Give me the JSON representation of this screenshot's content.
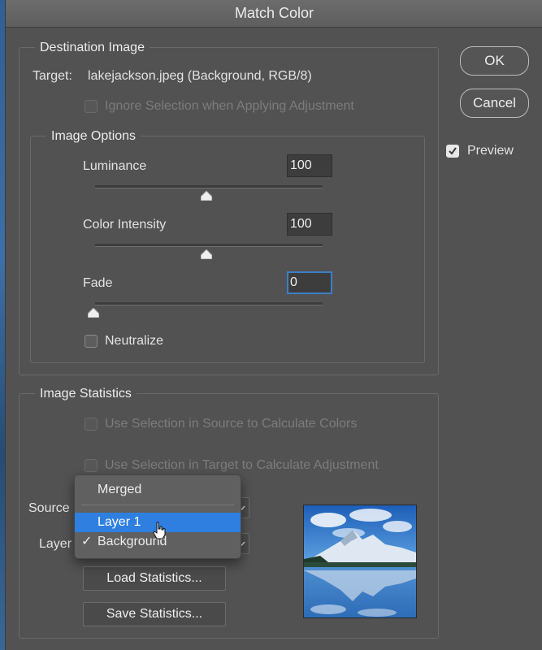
{
  "dialog": {
    "title": "Match Color"
  },
  "buttons": {
    "ok": "OK",
    "cancel": "Cancel"
  },
  "preview": {
    "label": "Preview",
    "checked": true
  },
  "destination": {
    "legend": "Destination Image",
    "target_label": "Target:",
    "target_value": "lakejackson.jpeg (Background, RGB/8)",
    "ignore_selection": "Ignore Selection when Applying Adjustment"
  },
  "image_options": {
    "legend": "Image Options",
    "luminance": {
      "label": "Luminance",
      "value": "100"
    },
    "color_intensity": {
      "label": "Color Intensity",
      "value": "100"
    },
    "fade": {
      "label": "Fade",
      "value": "0"
    },
    "neutralize": "Neutralize"
  },
  "image_statistics": {
    "legend": "Image Statistics",
    "use_selection_source": "Use Selection in Source to Calculate Colors",
    "use_selection_target": "Use Selection in Target to Calculate Adjustment",
    "source_label": "Source",
    "layer_label": "Layer",
    "load_statistics": "Load Statistics...",
    "save_statistics": "Save Statistics..."
  },
  "layer_menu": {
    "items": [
      "Merged",
      "Layer 1",
      "Background"
    ],
    "highlighted": "Layer 1",
    "checked": "Background",
    "check_mark": "✓"
  },
  "colors": {
    "dialog_bg": "#525252",
    "accent": "#2f7fe0",
    "focus_ring": "#3d7fc6"
  }
}
